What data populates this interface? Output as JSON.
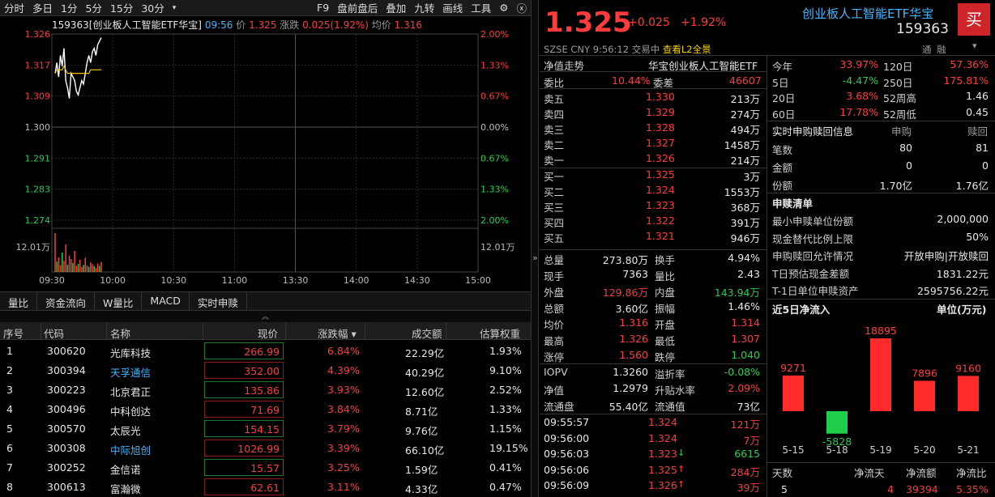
{
  "toolbar": {
    "items": [
      "分时",
      "多日",
      "1分",
      "5分",
      "15分",
      "30分",
      "▾",
      "F9",
      "盘前盘后",
      "叠加",
      "九转",
      "画线",
      "工具"
    ]
  },
  "chart_head": {
    "code_name": "159363[创业板人工智能ETF华宝]",
    "time": "09:56",
    "price_label": "价",
    "price": "1.325",
    "chg_label": "涨跌",
    "chg": "0.025(1.92%)",
    "avg_label": "均价",
    "avg": "1.316"
  },
  "chart_data": {
    "type": "line",
    "x": [
      "09:30",
      "09:31",
      "09:32",
      "09:33",
      "09:34",
      "09:35",
      "09:36",
      "09:37",
      "09:38",
      "09:39",
      "09:40",
      "09:41",
      "09:42",
      "09:43",
      "09:44",
      "09:45",
      "09:46",
      "09:47",
      "09:48",
      "09:49",
      "09:50",
      "09:51",
      "09:52",
      "09:53",
      "09:54",
      "09:55",
      "09:56"
    ],
    "series": [
      {
        "values": [
          1.315,
          1.318,
          1.314,
          1.32,
          1.317,
          1.322,
          1.313,
          1.311,
          1.308,
          1.315,
          1.314,
          1.313,
          1.31,
          1.309,
          1.311,
          1.313,
          1.312,
          1.315,
          1.318,
          1.32,
          1.318,
          1.321,
          1.322,
          1.32,
          1.323,
          1.324,
          1.325
        ]
      },
      {
        "values": [
          1.315,
          1.316,
          1.316,
          1.316,
          1.316,
          1.317,
          1.316,
          1.315,
          1.315,
          1.315,
          1.315,
          1.315,
          1.315,
          1.315,
          1.315,
          1.315,
          1.315,
          1.315,
          1.315,
          1.315,
          1.316,
          1.316,
          1.316,
          1.316,
          1.316,
          1.316,
          1.316
        ]
      }
    ],
    "volume": [
      12.01,
      3.2,
      4.5,
      2.1,
      6.0,
      3.4,
      8.5,
      2.2,
      5.1,
      4.0,
      2.8,
      6.5,
      1.9,
      2.5,
      3.8,
      1.5,
      2.2,
      4.4,
      2.0,
      1.6,
      3.0,
      2.4,
      1.8,
      1.2,
      2.6,
      1.9,
      3.1
    ],
    "ylim": [
      1.274,
      1.326
    ],
    "left_ticks": [
      "1.326",
      "1.317",
      "1.309",
      "1.300",
      "1.291",
      "1.283",
      "1.274"
    ],
    "right_ticks": [
      "2.00%",
      "1.33%",
      "0.67%",
      "0.00%",
      "0.67%",
      "1.33%",
      "2.00%"
    ],
    "vol_label": "12.01万",
    "xticks": [
      "09:30",
      "10:00",
      "10:30",
      "11:00",
      "13:30",
      "14:00",
      "14:30",
      "15:00"
    ]
  },
  "tabs": [
    "量比",
    "资金流向",
    "W量比",
    "MACD",
    "实时申赎"
  ],
  "holdings": {
    "headers": [
      "序号",
      "代码",
      "名称",
      "现价",
      "涨跌幅 ▾",
      "成交额",
      "估算权重"
    ],
    "rows": [
      [
        "1",
        "300620",
        "光库科技",
        "266.99",
        "6.84%",
        "22.29亿",
        "1.93%"
      ],
      [
        "2",
        "300394",
        "天孚通信",
        "352.00",
        "4.39%",
        "40.29亿",
        "9.10%"
      ],
      [
        "3",
        "300223",
        "北京君正",
        "135.86",
        "3.93%",
        "12.60亿",
        "2.52%"
      ],
      [
        "4",
        "300496",
        "中科创达",
        "71.69",
        "3.84%",
        "8.71亿",
        "1.33%"
      ],
      [
        "5",
        "300570",
        "太辰光",
        "154.15",
        "3.79%",
        "9.76亿",
        "1.15%"
      ],
      [
        "6",
        "300308",
        "中际旭创",
        "1026.99",
        "3.39%",
        "66.10亿",
        "19.15%"
      ],
      [
        "7",
        "300252",
        "金信诺",
        "15.57",
        "3.25%",
        "1.59亿",
        "0.41%"
      ],
      [
        "8",
        "300613",
        "富瀚微",
        "62.61",
        "3.11%",
        "4.33亿",
        "0.47%"
      ]
    ]
  },
  "quote": {
    "price": "1.325",
    "chg": "+0.025",
    "pct": "+1.92%",
    "name": "创业板人工智能ETF华宝",
    "code": "159363",
    "buy": "买",
    "market": "SZSE",
    "currency": "CNY",
    "time": "9:56:12",
    "status": "交易中",
    "l2": "查看L2全景",
    "tong": "通",
    "rong": "融"
  },
  "orderbook": {
    "title": "净值走势",
    "name": "华宝创业板人工智能ETF",
    "wb_label": "委比",
    "wb": "10.44%",
    "wc_label": "委差",
    "wc": "46607",
    "asks": [
      [
        "卖五",
        "1.330",
        "213万"
      ],
      [
        "卖四",
        "1.329",
        "274万"
      ],
      [
        "卖三",
        "1.328",
        "494万"
      ],
      [
        "卖二",
        "1.327",
        "1458万"
      ],
      [
        "卖一",
        "1.326",
        "214万"
      ]
    ],
    "bids": [
      [
        "买一",
        "1.325",
        "3万"
      ],
      [
        "买二",
        "1.324",
        "1553万"
      ],
      [
        "买三",
        "1.323",
        "368万"
      ],
      [
        "买四",
        "1.322",
        "391万"
      ],
      [
        "买五",
        "1.321",
        "946万"
      ]
    ]
  },
  "stats": [
    [
      "总量",
      "273.80万",
      "换手",
      "4.94%"
    ],
    [
      "现手",
      "7363",
      "量比",
      "2.43"
    ],
    [
      "外盘",
      "129.86万",
      "内盘",
      "143.94万"
    ],
    [
      "总额",
      "3.60亿",
      "振幅",
      "1.46%"
    ],
    [
      "均价",
      "1.316",
      "开盘",
      "1.314"
    ],
    [
      "最高",
      "1.326",
      "最低",
      "1.307"
    ],
    [
      "涨停",
      "1.560",
      "跌停",
      "1.040"
    ]
  ],
  "iopv": [
    [
      "IOPV",
      "1.3260",
      "溢折率",
      "-0.08%"
    ],
    [
      "净值",
      "1.2979",
      "升贴水率",
      "2.09%"
    ],
    [
      "流通盘",
      "55.40亿",
      "流通值",
      "73亿"
    ]
  ],
  "ticks": [
    [
      "09:55:57",
      "1.324",
      "",
      "121万"
    ],
    [
      "09:56:00",
      "1.324",
      "",
      "7万"
    ],
    [
      "09:56:03",
      "1.323",
      "↓",
      "6615"
    ],
    [
      "09:56:06",
      "1.325",
      "↑",
      "284万"
    ],
    [
      "09:56:09",
      "1.326",
      "↑",
      "39万"
    ]
  ],
  "perf": [
    [
      "今年",
      "33.97%",
      "120日",
      "57.36%"
    ],
    [
      "5日",
      "-4.47%",
      "250日",
      "175.81%"
    ],
    [
      "20日",
      "3.68%",
      "52周高",
      "1.46"
    ],
    [
      "60日",
      "17.78%",
      "52周低",
      "0.45"
    ]
  ],
  "sr": {
    "title": "实时申购赎回信息",
    "sub": "申购",
    "red": "赎回",
    "rows": [
      [
        "笔数",
        "80",
        "81"
      ],
      [
        "金额",
        "0",
        "0"
      ],
      [
        "份额",
        "1.70亿",
        "1.76亿"
      ]
    ]
  },
  "list": {
    "title": "申赎清单",
    "rows": [
      [
        "最小申赎单位份额",
        "2,000,000"
      ],
      [
        "现金替代比例上限",
        "50%"
      ],
      [
        "申购赎回允许情况",
        "开放申购|开放赎回"
      ],
      [
        "T日预估现金差额",
        "1831.22元"
      ],
      [
        "T-1日单位申赎资产",
        "2595756.22元"
      ]
    ]
  },
  "flow": {
    "title": "近5日净流入",
    "unit": "单位(万元)",
    "dates": [
      "5-15",
      "5-18",
      "5-19",
      "5-20",
      "5-21"
    ],
    "values": [
      9271,
      -5828,
      18895,
      7896,
      9160
    ],
    "headers": [
      "天数",
      "净流天",
      "净流额",
      "净流比"
    ],
    "summary": [
      "5",
      "4",
      "39394",
      "5.35%"
    ]
  }
}
